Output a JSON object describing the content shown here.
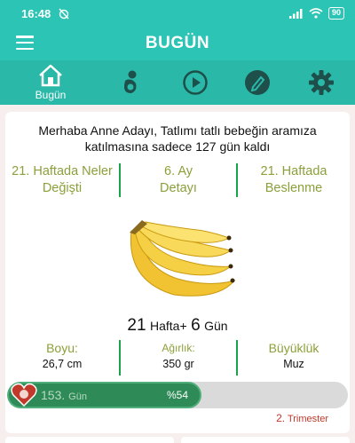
{
  "status_bar": {
    "time": "16:48",
    "battery": "90"
  },
  "app_bar": {
    "title": "BUGÜN"
  },
  "tabs": [
    {
      "label": "Bugün",
      "icon": "home-icon"
    },
    {
      "label": "",
      "icon": "baby-icon"
    },
    {
      "label": "",
      "icon": "play-icon"
    },
    {
      "label": "",
      "icon": "pencil-icon"
    },
    {
      "label": "",
      "icon": "gear-icon"
    }
  ],
  "greeting": {
    "line1": "Merhaba Anne Adayı, Tatlımı tatlı bebeğin aramıza",
    "line2": "katılmasına sadece 127 gün kaldı"
  },
  "links": [
    {
      "line1": "21. Haftada Neler",
      "line2": "Değişti"
    },
    {
      "line1": "6. Ay",
      "line2": "Detayı"
    },
    {
      "line1": "21. Haftada",
      "line2": "Beslenme"
    }
  ],
  "fruit_icon": "banana",
  "age": {
    "weeks": "21",
    "weeks_unit": "Hafta+",
    "days": "6",
    "days_unit": "Gün"
  },
  "stats": [
    {
      "label": "Boyu:",
      "value": "26,7 cm"
    },
    {
      "label": "Ağırlık:",
      "value": "350 gr"
    },
    {
      "label": "Büyüklük",
      "value": "Muz"
    }
  ],
  "progress": {
    "days": "153.",
    "days_unit": "Gün",
    "percent_label": "%54",
    "fraction": 0.54
  },
  "trimester": {
    "number": "2.",
    "label": "Trimester"
  },
  "colors": {
    "primary": "#2cc4b4",
    "tab_bar": "#2ab8a9",
    "accent_text": "#8ba03a",
    "divider": "#1aa34a",
    "progress": "#2e8b57",
    "trimester": "#c0392b"
  }
}
